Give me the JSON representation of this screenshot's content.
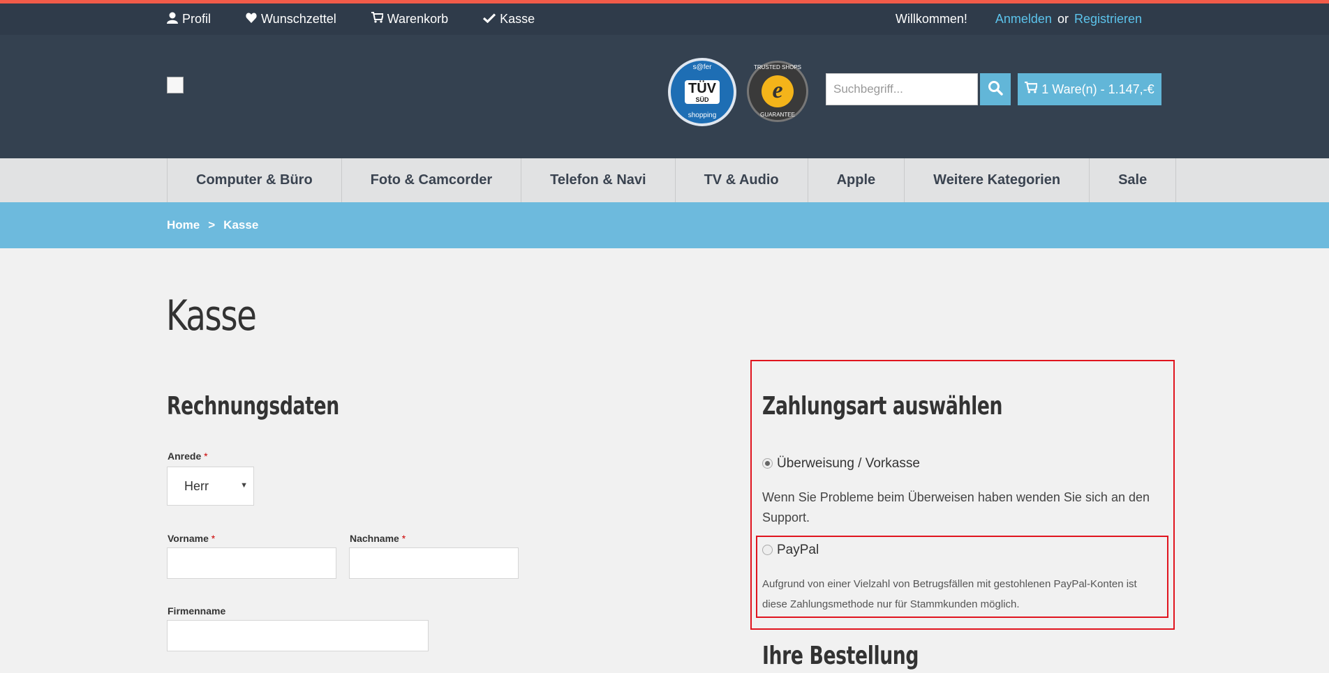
{
  "topnav": {
    "profile": "Profil",
    "wishlist": "Wunschzettel",
    "cart": "Warenkorb",
    "checkout": "Kasse",
    "welcome": "Willkommen!",
    "login": "Anmelden",
    "or": "or",
    "register": "Registrieren"
  },
  "header": {
    "search_placeholder": "Suchbegriff...",
    "cart_summary": "1 Ware(n) - 1.147,-€",
    "tuv_top": "s@fer",
    "tuv_main": "TÜV",
    "tuv_sub": "SÜD",
    "tuv_bottom": "shopping",
    "trusted_top": "TRUSTED SHOPS",
    "trusted_mark": "e",
    "trusted_bottom": "GUARANTEE"
  },
  "categories": [
    "Computer & Büro",
    "Foto & Camcorder",
    "Telefon & Navi",
    "TV & Audio",
    "Apple",
    "Weitere Kategorien",
    "Sale"
  ],
  "breadcrumb": {
    "home": "Home",
    "sep": ">",
    "current": "Kasse"
  },
  "page_title": "Kasse",
  "billing": {
    "heading": "Rechnungsdaten",
    "salutation_label": "Anrede",
    "salutation_value": "Herr",
    "firstname_label": "Vorname",
    "lastname_label": "Nachname",
    "company_label": "Firmenname",
    "required_mark": "*"
  },
  "payment": {
    "heading": "Zahlungsart auswählen",
    "option1_label": "Überweisung / Vorkasse",
    "option1_note": "Wenn Sie Probleme beim Überweisen haben wenden Sie sich an den Support.",
    "option2_label": "PayPal",
    "option2_note": "Aufgrund von einer Vielzahl von Betrugsfällen mit gestohlenen PayPal-Konten ist diese Zahlungsmethode nur für Stammkunden möglich."
  },
  "order": {
    "heading": "Ihre Bestellung"
  },
  "colors": {
    "accent_red": "#f25b49",
    "header_dark": "#344150",
    "link_blue": "#5cc3eb",
    "breadcrumb_blue": "#6dbadd",
    "highlight_red": "#e0141e"
  }
}
